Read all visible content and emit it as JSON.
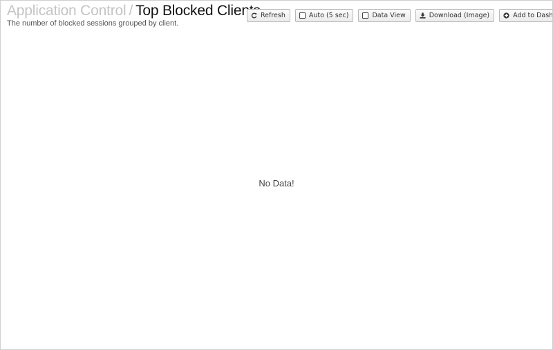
{
  "header": {
    "breadcrumb_parent": "Application Control",
    "separator": "/",
    "title": "Top Blocked Clients",
    "description": "The number of blocked sessions grouped by client."
  },
  "toolbar": {
    "refresh_label": "Refresh",
    "auto_label": "Auto (5 sec)",
    "auto_checked": false,
    "data_view_label": "Data View",
    "data_view_checked": false,
    "download_label": "Download (Image)",
    "add_dashboard_label": "Add to Dashb"
  },
  "chart": {
    "empty_message": "No Data!"
  },
  "icons": {
    "refresh": "refresh-icon",
    "download": "download-icon",
    "add": "plus-circle-icon"
  }
}
